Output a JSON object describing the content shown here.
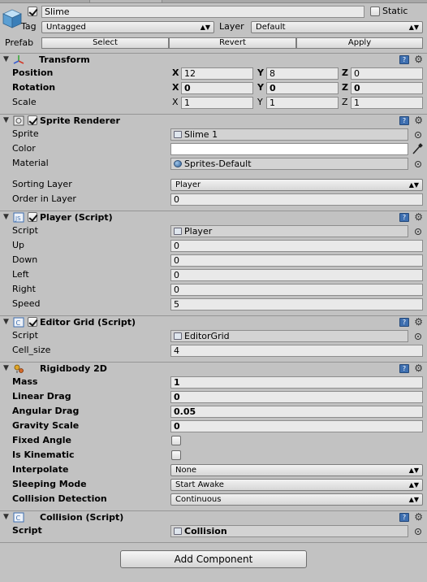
{
  "gameobject": {
    "name": "Slime",
    "static_label": "Static",
    "tag_label": "Tag",
    "tag_value": "Untagged",
    "layer_label": "Layer",
    "layer_value": "Default",
    "prefab_label": "Prefab",
    "prefab_buttons": [
      "Select",
      "Revert",
      "Apply"
    ]
  },
  "transform": {
    "title": "Transform",
    "position_label": "Position",
    "rotation_label": "Rotation",
    "scale_label": "Scale",
    "axes": [
      "X",
      "Y",
      "Z"
    ],
    "position": [
      "12",
      "8",
      "0"
    ],
    "rotation": [
      "0",
      "0",
      "0"
    ],
    "scale": [
      "1",
      "1",
      "1"
    ]
  },
  "sprite_renderer": {
    "title": "Sprite Renderer",
    "sprite_label": "Sprite",
    "sprite_value": "Slime 1",
    "color_label": "Color",
    "color_value": "#ffffff",
    "material_label": "Material",
    "material_value": "Sprites-Default",
    "sorting_layer_label": "Sorting Layer",
    "sorting_layer_value": "Player",
    "order_label": "Order in Layer",
    "order_value": "0"
  },
  "player_script": {
    "title": "Player (Script)",
    "script_label": "Script",
    "script_value": "Player",
    "fields": [
      {
        "label": "Up",
        "value": "0"
      },
      {
        "label": "Down",
        "value": "0"
      },
      {
        "label": "Left",
        "value": "0"
      },
      {
        "label": "Right",
        "value": "0"
      },
      {
        "label": "Speed",
        "value": "5"
      }
    ]
  },
  "editor_grid": {
    "title": "Editor Grid (Script)",
    "script_label": "Script",
    "script_value": "EditorGrid",
    "cell_size_label": "Cell_size",
    "cell_size_value": "4"
  },
  "rigidbody": {
    "title": "Rigidbody 2D",
    "mass_label": "Mass",
    "mass_value": "1",
    "linear_drag_label": "Linear Drag",
    "linear_drag_value": "0",
    "angular_drag_label": "Angular Drag",
    "angular_drag_value": "0.05",
    "gravity_label": "Gravity Scale",
    "gravity_value": "0",
    "fixed_angle_label": "Fixed Angle",
    "fixed_angle_checked": false,
    "kinematic_label": "Is Kinematic",
    "kinematic_checked": false,
    "interpolate_label": "Interpolate",
    "interpolate_value": "None",
    "sleeping_label": "Sleeping Mode",
    "sleeping_value": "Start Awake",
    "collision_label": "Collision Detection",
    "collision_value": "Continuous"
  },
  "collision_script": {
    "title": "Collision (Script)",
    "script_label": "Script",
    "script_value": "Collision"
  },
  "add_component_label": "Add Component",
  "icons": {
    "help": "help-book-icon",
    "gear": "gear-icon",
    "picker": "object-picker-icon",
    "eyedropper": "eyedropper-icon"
  },
  "colors": {
    "inspector_bg": "#c2c2c2",
    "help_icon": "#3e6fb0"
  }
}
